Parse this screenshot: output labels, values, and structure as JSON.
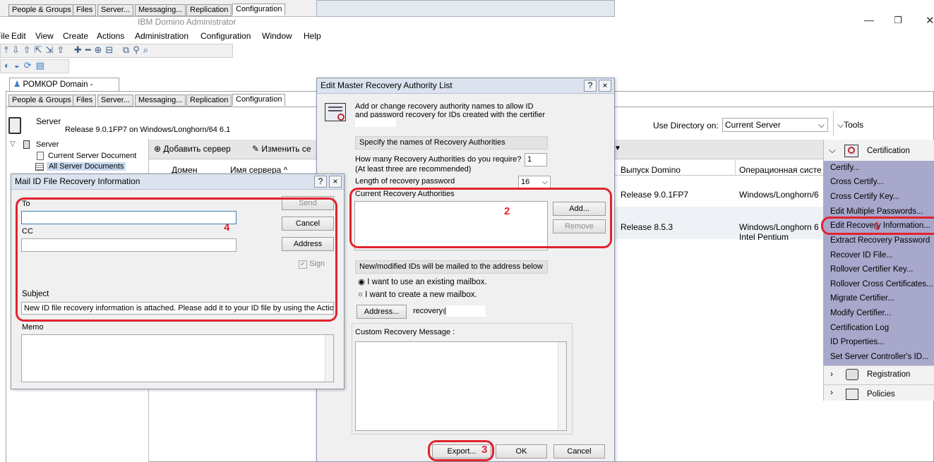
{
  "bg_tabs": [
    "People & Groups",
    "Files",
    "Server...",
    "Messaging...",
    "Replication",
    "Configuration"
  ],
  "app_title": "IBM Domino Administrator",
  "menu": [
    "File",
    "Edit",
    "View",
    "Create",
    "Actions",
    "Administration",
    "Configuration",
    "Window",
    "Help"
  ],
  "domain_tab": "РОМКОР Domain - ezop...",
  "main_tabs": [
    "People & Groups",
    "Files",
    "Server...",
    "Messaging...",
    "Replication",
    "Configuration"
  ],
  "server_header": {
    "label": "Server",
    "release": "Release 9.0.1FP7 on Windows/Longhorn/64 6.1"
  },
  "use_directory": {
    "label": "Use Directory on:",
    "value": "Current Server"
  },
  "tools_label": "Tools",
  "tree": {
    "root": "Server",
    "items": [
      "Current Server Document",
      "All Server Documents"
    ]
  },
  "view_toolbar": {
    "add_server": "Добавить сервер",
    "edit_server": "Изменить се"
  },
  "view_columns": [
    "Домен",
    "Имя сервера",
    "Выпуск Domino",
    "Операционная систе"
  ],
  "view_rows": [
    {
      "release": "Release 9.0.1FP7",
      "os": "Windows/Longhorn/6"
    },
    {
      "release": "Release 8.5.3",
      "os": "Windows/Longhorn 6",
      "os2": "Intel Pentium"
    }
  ],
  "certification_panel": {
    "title": "Certification",
    "items": [
      "Certify...",
      "Cross Certify...",
      "Cross Certify Key...",
      "Edit Multiple Passwords...",
      "Edit Recovery Information...",
      "Extract Recovery Password",
      "Recover ID File...",
      "Rollover Certifier Key...",
      "Rollover Cross Certificates...",
      "Migrate Certifier...",
      "Modify Certifier...",
      "Certification Log",
      "ID Properties...",
      "Set Server Controller's ID..."
    ],
    "registration": "Registration",
    "policies": "Policies"
  },
  "master_dialog": {
    "title": "Edit Master Recovery Authority List",
    "help": "?",
    "close": "×",
    "intro": "Add or change recovery authority names to allow ID and password recovery for IDs created with the certifier",
    "specify_header": "Specify the names of Recovery Authorities",
    "how_many_label": "How many Recovery Authorities do you require?",
    "how_many_hint": "(At least three are recommended)",
    "how_many_value": "1",
    "length_label": "Length of recovery password",
    "length_value": "16",
    "current_label": "Current Recovery Authorities",
    "add_btn": "Add...",
    "remove_btn": "Remove",
    "mail_header": "New/modified IDs will be mailed to the address below",
    "radio_existing": "I want to use an existing mailbox.",
    "radio_new": "I want to create a new mailbox.",
    "address_btn": "Address...",
    "address_value": "recovery@",
    "custom_label": "Custom Recovery Message :",
    "export_btn": "Export...",
    "ok_btn": "OK",
    "cancel_btn": "Cancel"
  },
  "mail_dialog": {
    "title": "Mail ID File Recovery Information",
    "help": "?",
    "close": "×",
    "to_label": "To",
    "cc_label": "CC",
    "send_btn": "Send",
    "cancel_btn": "Cancel",
    "address_btn": "Address",
    "sign_label": "Sign",
    "subject_label": "Subject",
    "subject_value": "New ID file recovery information is attached.  Please add it to your ID file by using the Actions",
    "memo_label": "Memo"
  },
  "annotations": [
    "1",
    "2",
    "3",
    "4"
  ],
  "colors": {
    "annotation_red": "#e0232e",
    "panel_purple": "#a8a8cc",
    "dialog_title": "#dde3ee"
  }
}
